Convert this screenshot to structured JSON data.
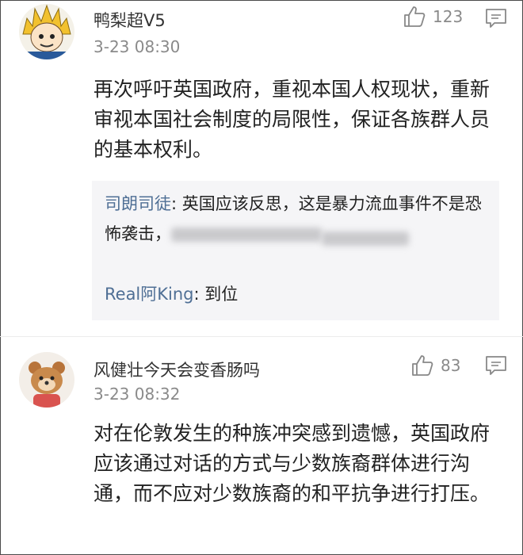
{
  "comments": [
    {
      "username": "鸭梨超V5",
      "time": "3-23 08:30",
      "likes": "123",
      "content": "再次呼吁英国政府，重视本国人权现状，重新审视本国社会制度的局限性，保证各族群人员的基本权利。",
      "avatar_icon": "dragonball-character-avatar-icon",
      "replies": [
        {
          "name": "司朗司徒",
          "sep": ": ",
          "text": "英国应该反思，这是暴力流血事件不是恐怖袭击，"
        },
        {
          "name": "Real阿King",
          "sep": ": ",
          "text": "到位"
        }
      ]
    },
    {
      "username": "风健壮今天会变香肠吗",
      "time": "3-23 08:32",
      "likes": "83",
      "content": "对在伦敦发生的种族冲突感到遗憾，英国政府应该通过对话的方式与少数族裔群体进行沟通，而不应对少数族裔的和平抗争进行打压。",
      "avatar_icon": "cartoon-bear-avatar-icon"
    }
  ],
  "colors": {
    "reply_name": "#4f6f95",
    "meta_gray": "#8a8a8a",
    "reply_bg": "#f5f5f7"
  }
}
